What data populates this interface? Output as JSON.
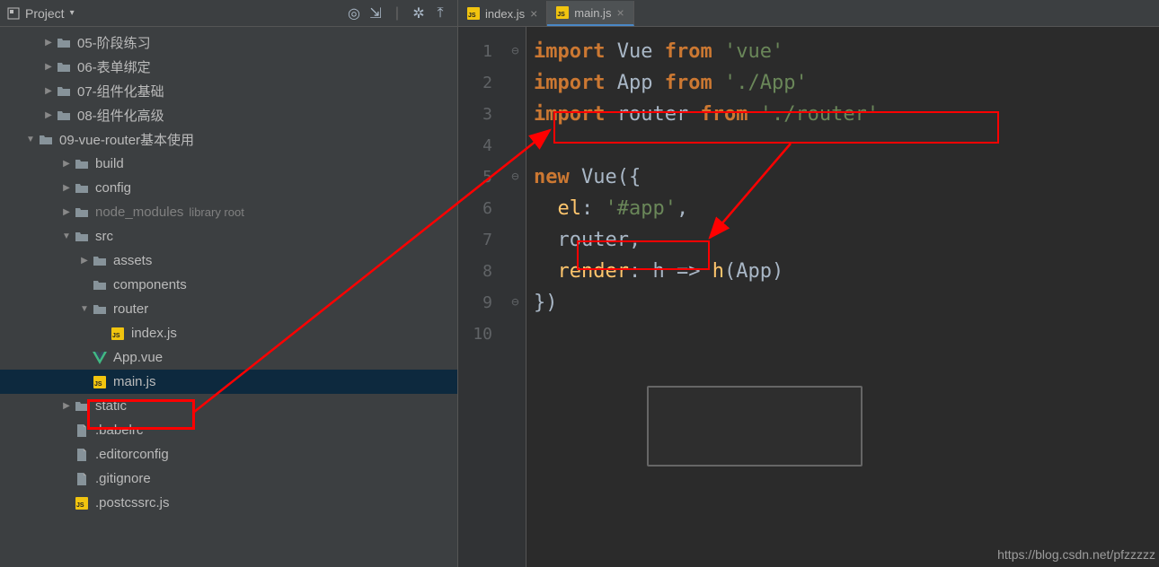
{
  "sidebar": {
    "header": {
      "title": "Project"
    },
    "tree": [
      {
        "label": "05-阶段练习",
        "icon": "folder",
        "indent": 2,
        "arrow": "right",
        "muted": false
      },
      {
        "label": "06-表单绑定",
        "icon": "folder",
        "indent": 2,
        "arrow": "right",
        "muted": false
      },
      {
        "label": "07-组件化基础",
        "icon": "folder",
        "indent": 2,
        "arrow": "right",
        "muted": false
      },
      {
        "label": "08-组件化高级",
        "icon": "folder",
        "indent": 2,
        "arrow": "right",
        "muted": false
      },
      {
        "label": "09-vue-router基本使用",
        "icon": "folder",
        "indent": 1,
        "arrow": "down",
        "muted": false
      },
      {
        "label": "build",
        "icon": "folder",
        "indent": 3,
        "arrow": "right",
        "muted": false
      },
      {
        "label": "config",
        "icon": "folder",
        "indent": 3,
        "arrow": "right",
        "muted": false
      },
      {
        "label": "node_modules",
        "icon": "folder",
        "indent": 3,
        "arrow": "right",
        "muted": true,
        "annotation": "library root"
      },
      {
        "label": "src",
        "icon": "folder",
        "indent": 3,
        "arrow": "down",
        "muted": false
      },
      {
        "label": "assets",
        "icon": "folder",
        "indent": 4,
        "arrow": "right",
        "muted": false
      },
      {
        "label": "components",
        "icon": "folder",
        "indent": 4,
        "arrow": "none",
        "muted": false
      },
      {
        "label": "router",
        "icon": "folder",
        "indent": 4,
        "arrow": "down",
        "muted": false
      },
      {
        "label": "index.js",
        "icon": "js",
        "indent": 5,
        "arrow": "none",
        "muted": false
      },
      {
        "label": "App.vue",
        "icon": "vue",
        "indent": 4,
        "arrow": "none",
        "muted": false
      },
      {
        "label": "main.js",
        "icon": "js",
        "indent": 4,
        "arrow": "none",
        "muted": false,
        "selected": true
      },
      {
        "label": "static",
        "icon": "folder",
        "indent": 3,
        "arrow": "right",
        "muted": false
      },
      {
        "label": ".babelrc",
        "icon": "file",
        "indent": 3,
        "arrow": "none",
        "muted": false
      },
      {
        "label": ".editorconfig",
        "icon": "file",
        "indent": 3,
        "arrow": "none",
        "muted": false
      },
      {
        "label": ".gitignore",
        "icon": "file",
        "indent": 3,
        "arrow": "none",
        "muted": false
      },
      {
        "label": ".postcssrc.js",
        "icon": "js",
        "indent": 3,
        "arrow": "none",
        "muted": false
      }
    ]
  },
  "tabs": [
    {
      "label": "index.js",
      "active": false
    },
    {
      "label": "main.js",
      "active": true
    }
  ],
  "code": {
    "line_numbers": [
      "1",
      "2",
      "3",
      "4",
      "5",
      "6",
      "7",
      "8",
      "9",
      "10"
    ],
    "tok": {
      "import": "import",
      "from": "from",
      "new": "new",
      "vue_str": "'vue'",
      "app_str": "'./App'",
      "router_str": "'./router'",
      "app_sel": "'#app'",
      "Vue": "Vue",
      "App": "App",
      "router": "router",
      "el": "el",
      "router_prop": "router",
      "render": "render",
      "h": "h",
      "open": "({",
      "close": "})",
      "comma": ","
    }
  },
  "watermark": "https://blog.csdn.net/pfzzzzz"
}
